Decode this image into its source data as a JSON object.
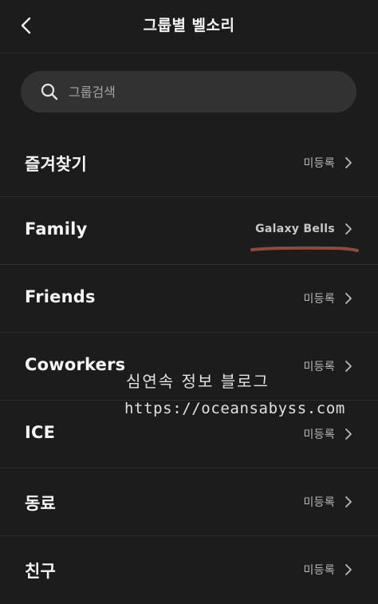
{
  "header": {
    "title": "그룹별 벨소리",
    "back_icon": "chevron-left-icon"
  },
  "search": {
    "placeholder": "그룹검색",
    "value": "",
    "icon": "search-icon"
  },
  "groups": [
    {
      "label": "즐겨찾기",
      "value": "미등록"
    },
    {
      "label": "Family",
      "value": "Galaxy Bells"
    },
    {
      "label": "Friends",
      "value": "미등록"
    },
    {
      "label": "Coworkers",
      "value": "미등록"
    },
    {
      "label": "ICE",
      "value": "미등록"
    },
    {
      "label": "동료",
      "value": "미등록"
    },
    {
      "label": "친구",
      "value": "미등록"
    }
  ],
  "watermark": {
    "line1": "심연속 정보 블로그",
    "line2": "https://oceansabyss.com"
  },
  "colors": {
    "background": "#1c1c1c",
    "search_bg": "#323232",
    "annotation_underline": "#8a4a3e"
  }
}
